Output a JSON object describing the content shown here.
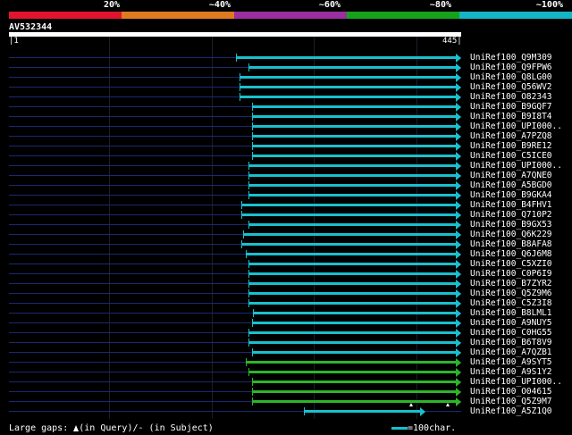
{
  "identity_scale": {
    "labels": [
      "20%",
      "~40%",
      "~60%",
      "~80%",
      "~100%"
    ],
    "colors": [
      "#e0152d",
      "#e07a20",
      "#9a2fa0",
      "#16a31c",
      "#14b5c4"
    ]
  },
  "query": {
    "name": "AV532344",
    "start": "1",
    "end": "445"
  },
  "hits": [
    {
      "name": "UniRef100_Q9M309",
      "start": 264,
      "color": "#18c0cf"
    },
    {
      "name": "UniRef100_Q9FPW6",
      "start": 278,
      "color": "#18c0cf"
    },
    {
      "name": "UniRef100_Q8LG00",
      "start": 268,
      "color": "#18c0cf"
    },
    {
      "name": "UniRef100_Q56WV2",
      "start": 268,
      "color": "#18c0cf"
    },
    {
      "name": "UniRef100_O82343",
      "start": 268,
      "color": "#18c0cf"
    },
    {
      "name": "UniRef100_B9GQF7",
      "start": 282,
      "color": "#18c0cf"
    },
    {
      "name": "UniRef100_B9I8T4",
      "start": 282,
      "color": "#18c0cf"
    },
    {
      "name": "UniRef100_UPI000..",
      "start": 282,
      "color": "#18c0cf"
    },
    {
      "name": "UniRef100_A7PZQ8",
      "start": 282,
      "color": "#18c0cf"
    },
    {
      "name": "UniRef100_B9RE12",
      "start": 282,
      "color": "#18c0cf"
    },
    {
      "name": "UniRef100_C5ICE0",
      "start": 282,
      "color": "#18c0cf"
    },
    {
      "name": "UniRef100_UPI000..",
      "start": 278,
      "color": "#18c0cf"
    },
    {
      "name": "UniRef100_A7QNE0",
      "start": 278,
      "color": "#18c0cf"
    },
    {
      "name": "UniRef100_A5BGD0",
      "start": 278,
      "color": "#18c0cf"
    },
    {
      "name": "UniRef100_B9GKA4",
      "start": 278,
      "color": "#18c0cf"
    },
    {
      "name": "UniRef100_B4FHV1",
      "start": 270,
      "color": "#18c0cf"
    },
    {
      "name": "UniRef100_Q710P2",
      "start": 270,
      "color": "#18c0cf"
    },
    {
      "name": "UniRef100_B9GX53",
      "start": 278,
      "color": "#18c0cf"
    },
    {
      "name": "UniRef100_Q6K229",
      "start": 272,
      "color": "#18c0cf"
    },
    {
      "name": "UniRef100_B8AFA8",
      "start": 270,
      "color": "#18c0cf"
    },
    {
      "name": "UniRef100_Q6J6M8",
      "start": 275,
      "color": "#18c0cf"
    },
    {
      "name": "UniRef100_C5XZI0",
      "start": 278,
      "color": "#18c0cf"
    },
    {
      "name": "UniRef100_C0P6I9",
      "start": 278,
      "color": "#18c0cf"
    },
    {
      "name": "UniRef100_B7ZYR2",
      "start": 278,
      "color": "#18c0cf"
    },
    {
      "name": "UniRef100_Q5Z9M6",
      "start": 278,
      "color": "#18c0cf"
    },
    {
      "name": "UniRef100_C5Z3I8",
      "start": 278,
      "color": "#18c0cf"
    },
    {
      "name": "UniRef100_B8LML1",
      "start": 283,
      "color": "#18c0cf"
    },
    {
      "name": "UniRef100_A9NUY5",
      "start": 282,
      "color": "#18c0cf"
    },
    {
      "name": "UniRef100_C0HG55",
      "start": 278,
      "color": "#18c0cf"
    },
    {
      "name": "UniRef100_B6T8V9",
      "start": 278,
      "color": "#18c0cf"
    },
    {
      "name": "UniRef100_A7QZB1",
      "start": 282,
      "color": "#18c0cf"
    },
    {
      "name": "UniRef100_A9SYT5",
      "start": 275,
      "color": "#2db52a"
    },
    {
      "name": "UniRef100_A9S1Y2",
      "start": 278,
      "color": "#2db52a"
    },
    {
      "name": "UniRef100_UPI000..",
      "start": 282,
      "color": "#2db52a"
    },
    {
      "name": "UniRef100_O04615",
      "start": 282,
      "color": "#2db52a"
    },
    {
      "name": "UniRef100_Q5Z9M7",
      "start": 282,
      "color": "#2db52a"
    },
    {
      "name": "UniRef100_A5Z1Q0",
      "start": 340,
      "end": 470,
      "color": "#18c0cf"
    }
  ],
  "footer": {
    "gaps_label": "Large gaps:",
    "in_query": "(in Query)/-",
    "in_subject": "(in Subject)",
    "scale_label": "=100char."
  }
}
